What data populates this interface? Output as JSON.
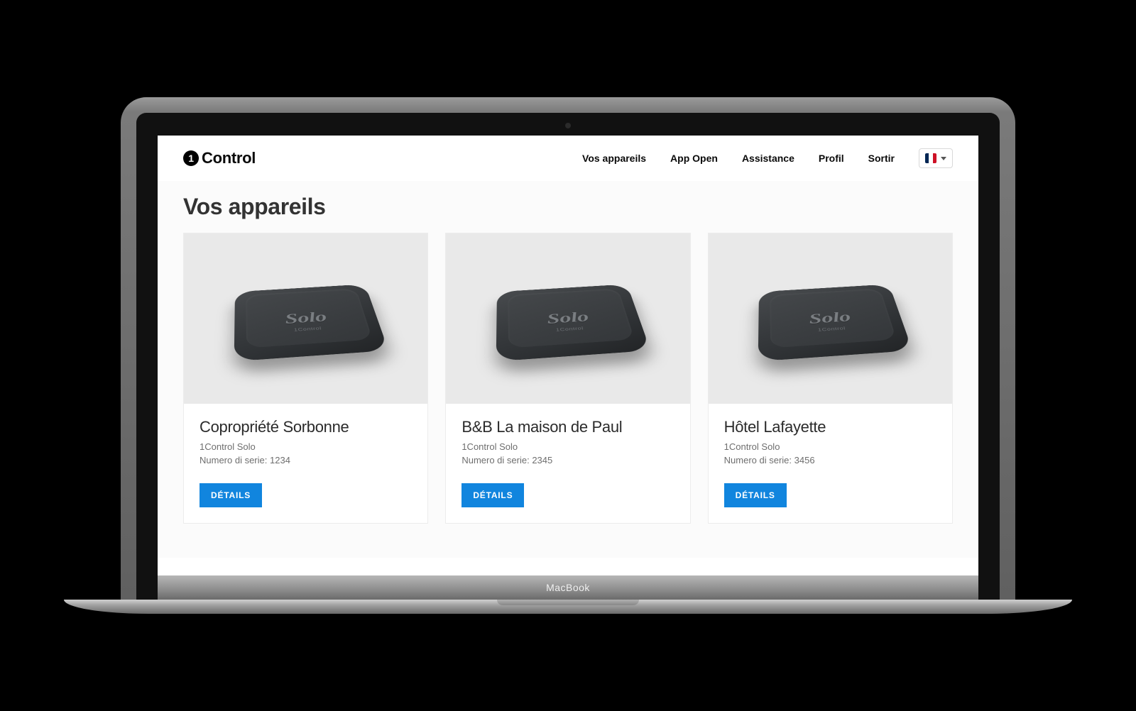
{
  "logo": {
    "text": "Control",
    "mark": "1"
  },
  "nav": {
    "items": [
      {
        "label": "Vos appareils"
      },
      {
        "label": "App Open"
      },
      {
        "label": "Assistance"
      },
      {
        "label": "Profil"
      },
      {
        "label": "Sortir"
      }
    ],
    "language_selected": "fr"
  },
  "page": {
    "title": "Vos appareils"
  },
  "serial_label": "Numero di serie:",
  "details_label": "DÉTAILS",
  "devices": [
    {
      "name": "Copropriété Sorbonne",
      "model": "1Control Solo",
      "serial": "1234"
    },
    {
      "name": "B&B La maison de Paul",
      "model": "1Control Solo",
      "serial": "2345"
    },
    {
      "name": "Hôtel Lafayette",
      "model": "1Control Solo",
      "serial": "3456"
    }
  ],
  "device_graphic": {
    "brand": "Solo",
    "sub": "1Control"
  },
  "laptop_label": "MacBook"
}
